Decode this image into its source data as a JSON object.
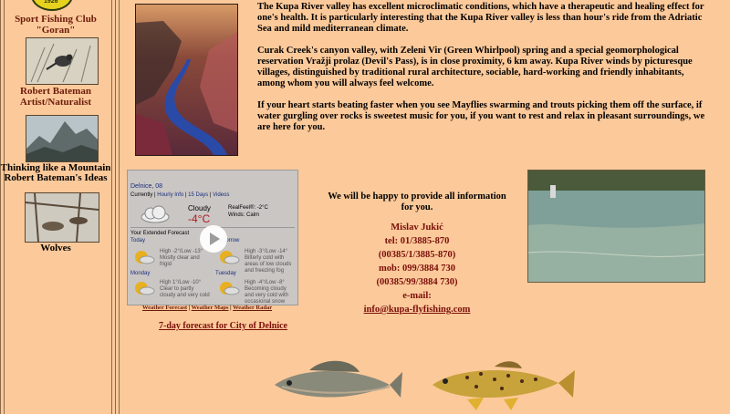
{
  "sidebar": {
    "logo_text": "1926",
    "club_name": "Sport Fishing Club",
    "club_nickname": "\"Goran\"",
    "items": [
      {
        "label_line1": "Robert Bateman",
        "label_line2": "Artist/Naturalist"
      },
      {
        "label_line1": "Thinking like a Mountain",
        "label_line2": "Robert Bateman's Ideas"
      },
      {
        "label_line1": "Wolves",
        "label_line2": ""
      }
    ]
  },
  "article": {
    "p1": "The Kupa River valley has excellent microclimatic conditions, which have a therapeutic and healing effect for one's health. It is particularly interesting that the Kupa River valley is less than hour's ride from the Adriatic Sea and mild mediterranean climate.",
    "p2": "Curak Creek's canyon valley, with Zeleni Vir (Green Whirlpool) spring and a special geomorphological reservation Vražji prolaz (Devil's Pass), is in close proximity, 6 km away. Kupa River winds by picturesque villages, distinguished by traditional rural architecture, sociable, hard-working and friendly inhabitants, among whom you will always feel welcome.",
    "p3": "If your heart starts beating faster when you see Mayflies swarming and trouts picking them off the surface, if water gurgling over rocks is sweetest music for you, if you want to rest and relax in pleasant surroundings, we are here for you."
  },
  "weather": {
    "city": "Delnice, 08",
    "nav_current": "Currently",
    "nav_hourly": "Hourly Info",
    "nav_15days": "15 Days",
    "nav_videos": "Videos",
    "condition": "Cloudy",
    "temperature": "-4°C",
    "realfeel": "RealFeel®: -2°C",
    "winds": "Winds: Calm",
    "extended_label": "Your Extended Forecast",
    "days": [
      {
        "name": "Today",
        "temps": "High -2°/Low -13°",
        "desc": "Mostly clear and frigid"
      },
      {
        "name": "Tomorrow",
        "temps": "High -3°/Low -14°",
        "desc": "Bitterly cold with areas of low clouds and freezing fog"
      },
      {
        "name": "Monday",
        "temps": "High 1°/Low -10°",
        "desc": "Clear to partly cloudy and very cold"
      },
      {
        "name": "Tuesday",
        "temps": "High -4°/Low -8°",
        "desc": "Becoming cloudy and very cold with occasional snow"
      }
    ],
    "link_forecast": "Weather Forecast",
    "link_maps": "Weather Maps",
    "link_radar": "Weather Radar",
    "sep": "|"
  },
  "forecast_link": "7-day forecast for City of Delnice",
  "contact": {
    "intro": "We will be happy to provide all information for you.",
    "name": "Mislav Jukić",
    "tel1": "tel: 01/3885-870",
    "tel2": "(00385/1/3885-870)",
    "mob1": "mob: 099/3884 730",
    "mob2": "(00385/99/3884 730)",
    "email_label": "e-mail:",
    "email": "info@kupa-flyfishing.com"
  },
  "colors": {
    "background": "#fcc99a",
    "link": "#7a0f0a",
    "divider": "#8a6a4a"
  }
}
